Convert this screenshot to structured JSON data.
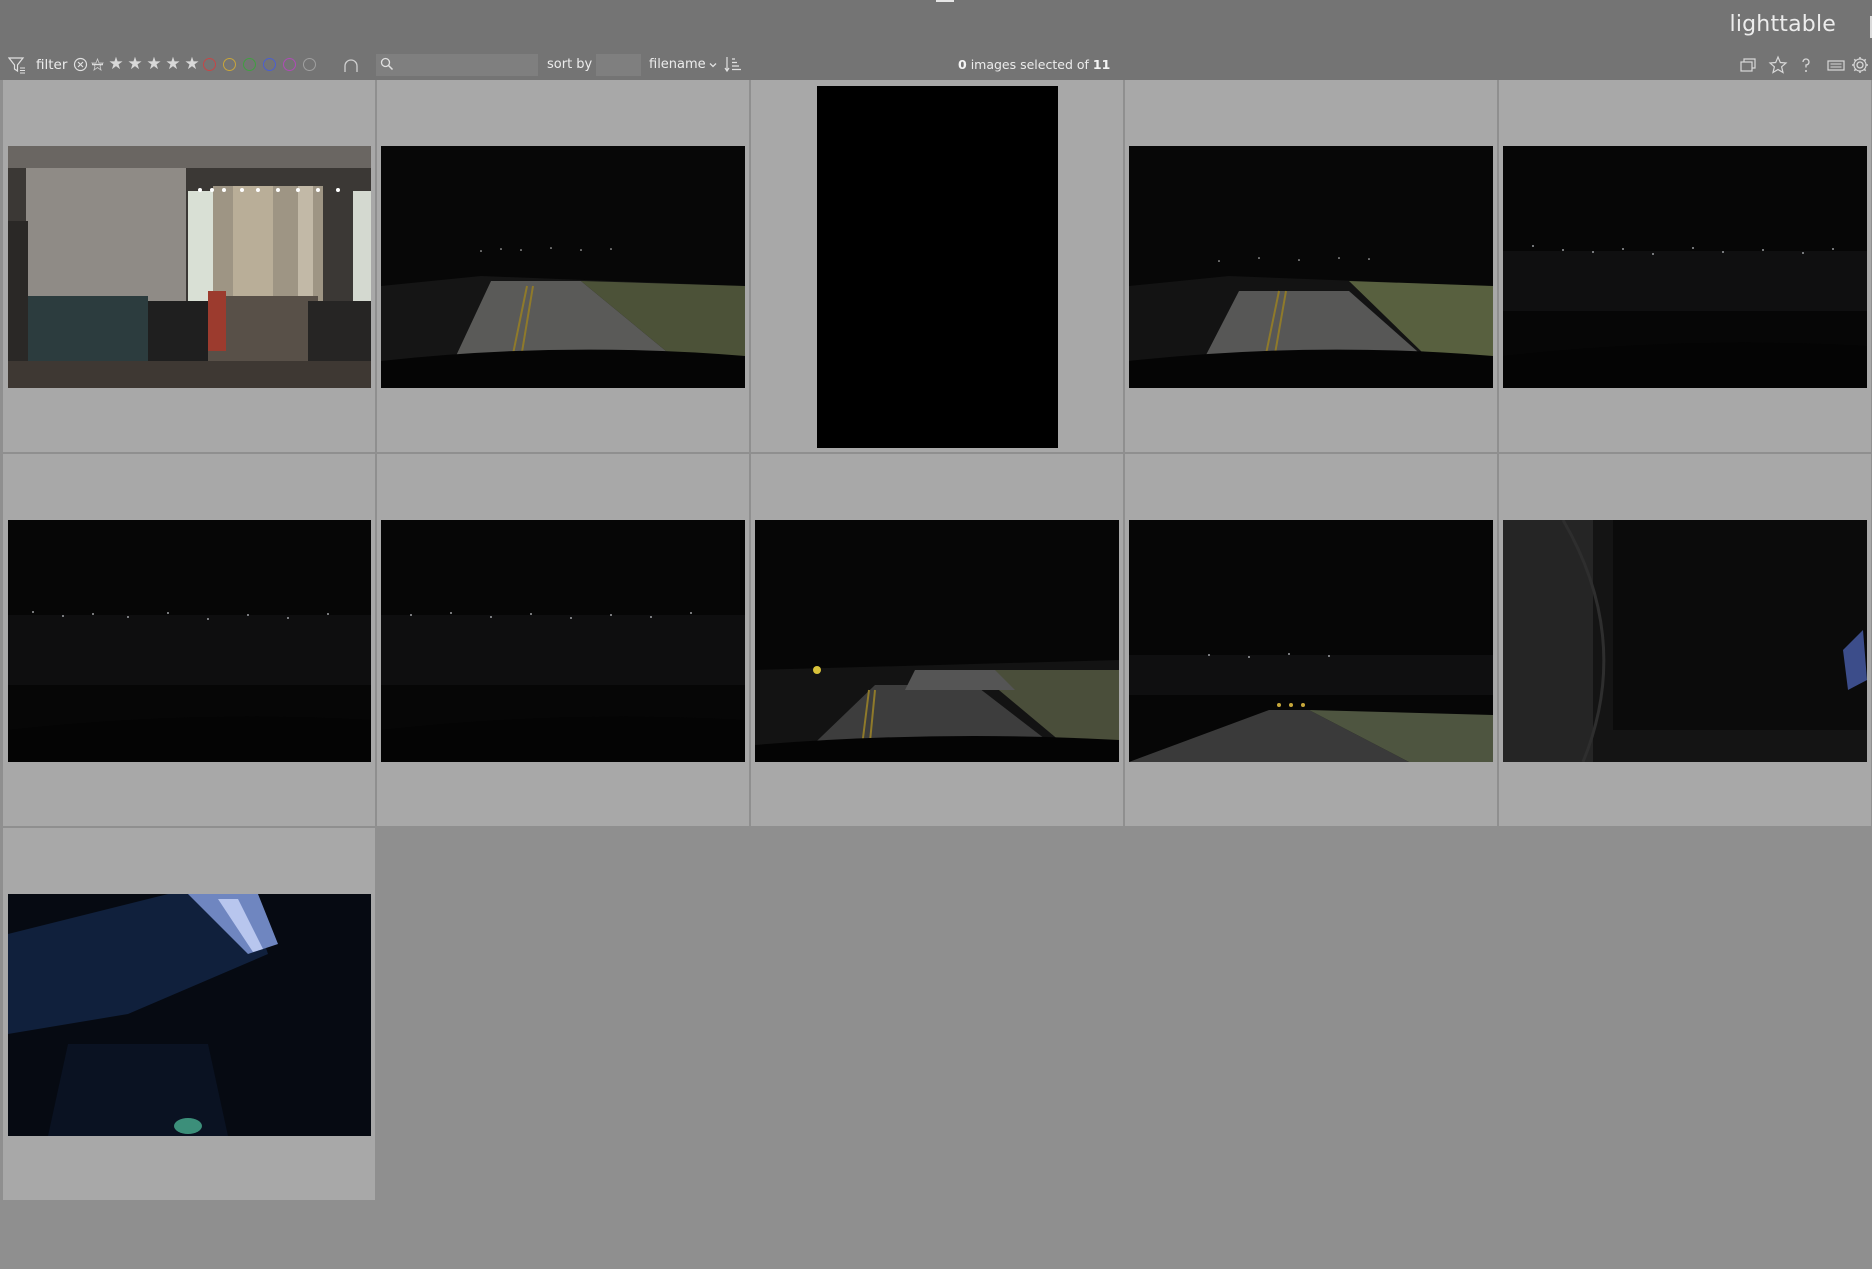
{
  "header": {
    "view_title": "lighttable"
  },
  "toolbar": {
    "filter_label": "filter",
    "search_placeholder": "",
    "sort_by_label": "sort by",
    "sort_value": "filename",
    "selection": {
      "selected_count": "0",
      "middle_text": "images selected of",
      "total_count": "11"
    },
    "color_labels": [
      "#c64646",
      "#c9a63a",
      "#3fa03f",
      "#4a5ed1",
      "#b04bb7",
      "#9a9a9a"
    ]
  },
  "collection": {
    "thumbnails": [
      {
        "index": 1,
        "subject": "indoor room with curtains"
      },
      {
        "index": 2,
        "subject": "night road with headlights"
      },
      {
        "index": 3,
        "subject": "black portrait frame"
      },
      {
        "index": 4,
        "subject": "night road with headlights"
      },
      {
        "index": 5,
        "subject": "city lights at night"
      },
      {
        "index": 6,
        "subject": "city lights at night"
      },
      {
        "index": 7,
        "subject": "city lights at night"
      },
      {
        "index": 8,
        "subject": "night road with sign"
      },
      {
        "index": 9,
        "subject": "night road with lights"
      },
      {
        "index": 10,
        "subject": "dark equipment close-up"
      },
      {
        "index": 11,
        "subject": "blue lit interior"
      }
    ]
  }
}
